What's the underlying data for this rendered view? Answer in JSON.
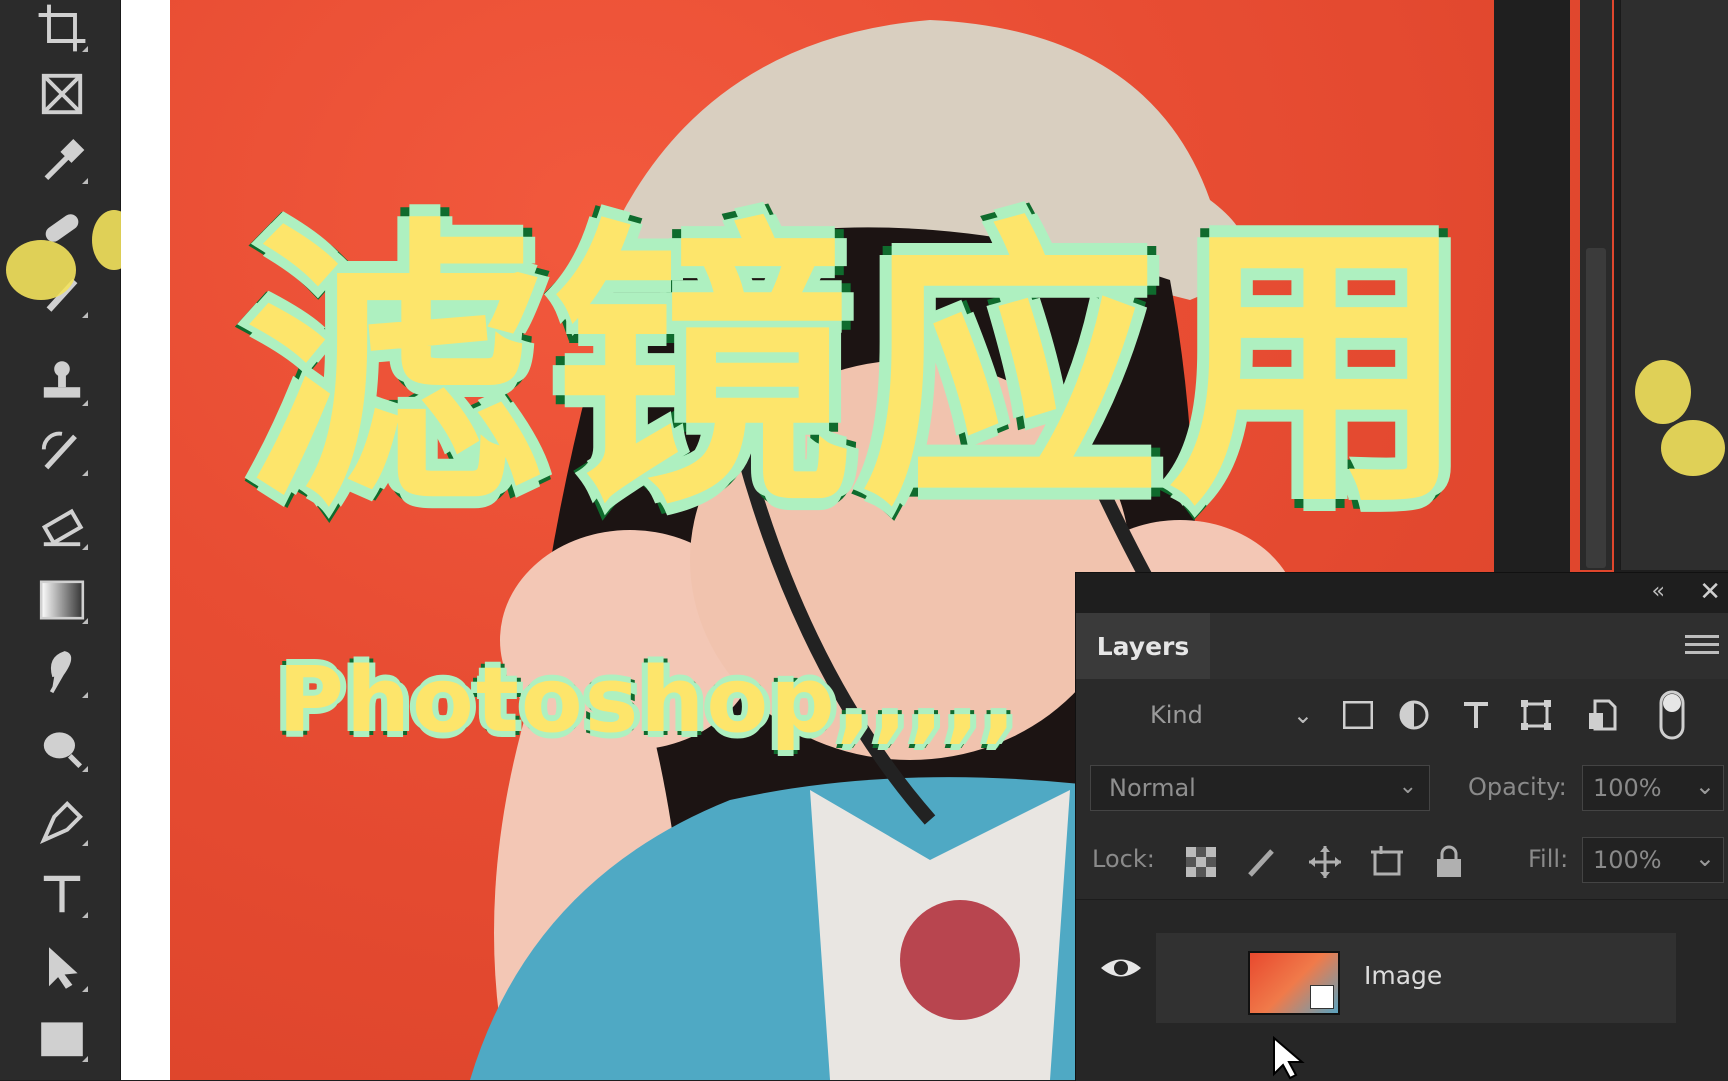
{
  "toolbar": {
    "tools": [
      "crop-icon",
      "frame-icon",
      "eyedropper-icon",
      "healing-brush-icon",
      "brush-icon",
      "stamp-icon",
      "history-brush-icon",
      "eraser-icon",
      "gradient-icon",
      "smudge-icon",
      "dodge-icon",
      "pen-icon",
      "type-icon",
      "move-select-icon",
      "rectangle-icon"
    ]
  },
  "overlay": {
    "title": "滤镜应用",
    "subtitle": "Photoshop,,,,,"
  },
  "layers_panel": {
    "tab": "Layers",
    "filter_kind": "Kind",
    "blend_mode": "Normal",
    "opacity_label": "Opacity:",
    "opacity_value": "100%",
    "lock_label": "Lock:",
    "fill_label": "Fill:",
    "fill_value": "100%",
    "collapse_glyph": "«",
    "close_glyph": "✕",
    "layers": [
      {
        "name": "Image",
        "visible": true
      }
    ]
  },
  "colors": {
    "title_fill": "#fde56b",
    "title_stroke": "#0f6b2d",
    "title_glow": "#aef0c0",
    "photo_bg": "#e84d33"
  }
}
